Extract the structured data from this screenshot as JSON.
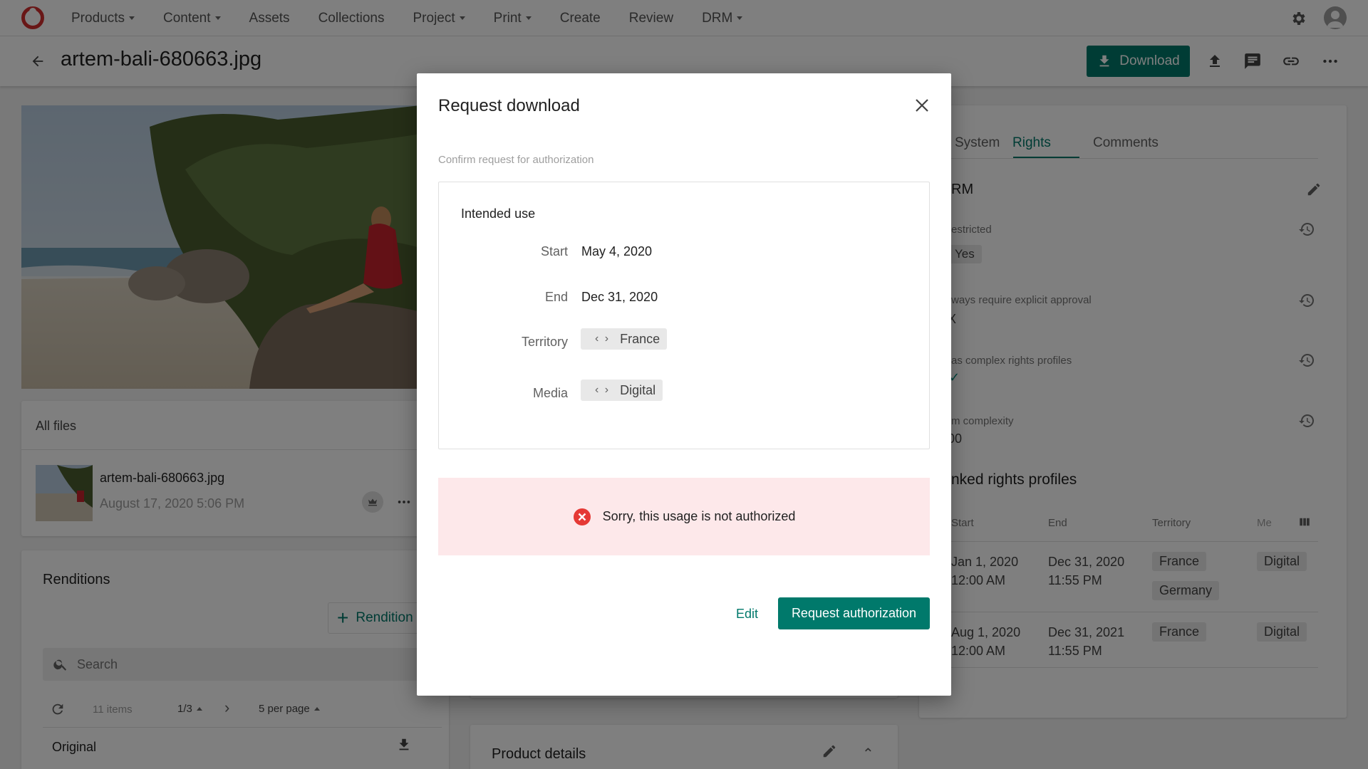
{
  "nav": {
    "items": [
      {
        "label": "Products",
        "caret": true
      },
      {
        "label": "Content",
        "caret": true
      },
      {
        "label": "Assets",
        "caret": false
      },
      {
        "label": "Collections",
        "caret": false
      },
      {
        "label": "Project",
        "caret": true
      },
      {
        "label": "Print",
        "caret": true
      },
      {
        "label": "Create",
        "caret": false
      },
      {
        "label": "Review",
        "caret": false
      },
      {
        "label": "DRM",
        "caret": true
      }
    ]
  },
  "header": {
    "title": "artem-bali-680663.jpg",
    "download_label": "Download"
  },
  "files": {
    "heading": "All files",
    "file_name": "artem-bali-680663.jpg",
    "file_date": "August 17, 2020 5:06 PM"
  },
  "renditions": {
    "heading": "Renditions",
    "add_label": "Rendition",
    "search_placeholder": "Search",
    "items_count": "11 items",
    "page": "1/3",
    "per_page": "5 per page",
    "first_row": "Original"
  },
  "product_details": {
    "heading": "Product details"
  },
  "rights_panel": {
    "tabs": [
      "System",
      "Rights",
      "Comments"
    ],
    "active_tab": "Rights",
    "section_title": "RM",
    "fields": [
      {
        "label": "estricted",
        "value": "Yes"
      },
      {
        "label": "ways require explicit approval",
        "value": "X"
      },
      {
        "label": "as complex rights profiles",
        "value": "✓"
      },
      {
        "label": "m complexity",
        "value": "00"
      }
    ],
    "linked_title": "nked rights profiles",
    "columns": [
      "Start",
      "End",
      "Territory",
      "Me"
    ],
    "rows": [
      {
        "start_date": "Jan 1, 2020",
        "start_time": "12:00 AM",
        "end_date": "Dec 31, 2020",
        "end_time": "11:55 PM",
        "territories": [
          "France",
          "Germany"
        ],
        "media": "Digital"
      },
      {
        "start_date": "Aug 1, 2020",
        "start_time": "12:00 AM",
        "end_date": "Dec 31, 2021",
        "end_time": "11:55 PM",
        "territories": [
          "France"
        ],
        "media": "Digital"
      }
    ]
  },
  "modal": {
    "title": "Request download",
    "subtitle": "Confirm request for authorization",
    "section_title": "Intended use",
    "start_label": "Start",
    "start_value": "May 4, 2020",
    "end_label": "End",
    "end_value": "Dec 31, 2020",
    "territory_label": "Territory",
    "territory_value": "France",
    "media_label": "Media",
    "media_value": "Digital",
    "error_message": "Sorry, this usage is not authorized",
    "edit_label": "Edit",
    "request_label": "Request authorization"
  },
  "colors": {
    "accent": "#00796b",
    "error": "#e53935",
    "error_bg": "#fde8ea"
  }
}
